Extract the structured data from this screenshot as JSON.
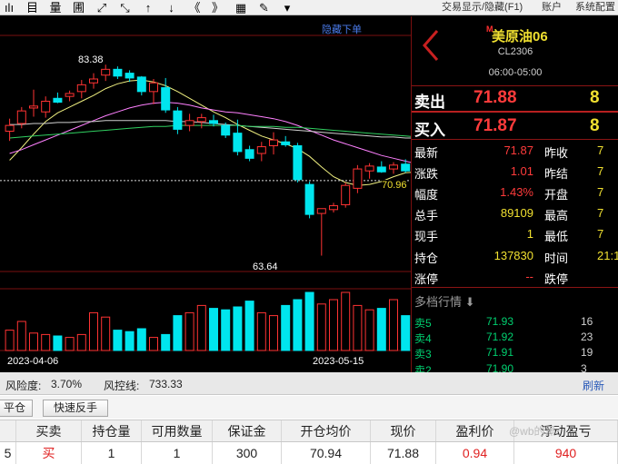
{
  "toolbar": {
    "icons": [
      "small-candle-icon",
      "list-icon",
      "volume-icon",
      "grid-icon",
      "zoom-in-icon",
      "zoom-out-icon",
      "arrow-up-icon",
      "arrow-down-icon",
      "double-left-icon",
      "double-right-icon",
      "layout-icon",
      "draw-icon",
      "dropdown-icon"
    ],
    "glyphs": [
      "ılı",
      "目",
      "量",
      "圃",
      "⤢",
      "⤡",
      "↑",
      "↓",
      "《",
      "》",
      "▦",
      "✎",
      "▾"
    ],
    "trade_toggle": "交易显示/隐藏(F1)",
    "account": "账户",
    "settings": "系统配置"
  },
  "chart": {
    "hide_order_label": "隐藏下单",
    "high_label": "83.38",
    "low_label": "63.64",
    "price_mark": "70.96",
    "date_start": "2023-04-06",
    "date_end": "2023-05-15"
  },
  "chart_data": {
    "type": "candlestick",
    "y_range": [
      62,
      88
    ],
    "candles": [
      {
        "o": 76.5,
        "h": 77.8,
        "l": 75.5,
        "c": 77.1
      },
      {
        "o": 77.3,
        "h": 79.0,
        "l": 76.8,
        "c": 78.6
      },
      {
        "o": 78.9,
        "h": 80.8,
        "l": 78.0,
        "c": 79.1
      },
      {
        "o": 78.5,
        "h": 80.1,
        "l": 77.9,
        "c": 79.6
      },
      {
        "o": 79.9,
        "h": 80.5,
        "l": 79.4,
        "c": 79.5
      },
      {
        "o": 80.1,
        "h": 80.7,
        "l": 79.6,
        "c": 80.4
      },
      {
        "o": 80.6,
        "h": 81.8,
        "l": 79.9,
        "c": 81.3
      },
      {
        "o": 81.5,
        "h": 82.5,
        "l": 80.9,
        "c": 81.9
      },
      {
        "o": 82.3,
        "h": 83.38,
        "l": 81.7,
        "c": 82.9
      },
      {
        "o": 82.9,
        "h": 83.2,
        "l": 81.9,
        "c": 82.2
      },
      {
        "o": 82.5,
        "h": 82.8,
        "l": 81.6,
        "c": 82.0
      },
      {
        "o": 82.1,
        "h": 82.2,
        "l": 80.2,
        "c": 80.6
      },
      {
        "o": 80.6,
        "h": 81.9,
        "l": 79.3,
        "c": 81.5
      },
      {
        "o": 81.0,
        "h": 82.0,
        "l": 78.4,
        "c": 78.7
      },
      {
        "o": 78.6,
        "h": 79.0,
        "l": 76.2,
        "c": 76.7
      },
      {
        "o": 77.1,
        "h": 78.3,
        "l": 76.5,
        "c": 77.6
      },
      {
        "o": 77.5,
        "h": 78.3,
        "l": 76.8,
        "c": 77.9
      },
      {
        "o": 77.6,
        "h": 78.2,
        "l": 77.0,
        "c": 77.3
      },
      {
        "o": 77.1,
        "h": 77.4,
        "l": 75.8,
        "c": 76.1
      },
      {
        "o": 76.3,
        "h": 77.7,
        "l": 74.0,
        "c": 74.4
      },
      {
        "o": 74.6,
        "h": 75.0,
        "l": 73.4,
        "c": 73.7
      },
      {
        "o": 74.2,
        "h": 75.4,
        "l": 73.4,
        "c": 74.9
      },
      {
        "o": 75.0,
        "h": 76.4,
        "l": 74.1,
        "c": 75.6
      },
      {
        "o": 75.4,
        "h": 76.0,
        "l": 74.9,
        "c": 75.1
      },
      {
        "o": 75.0,
        "h": 75.3,
        "l": 71.2,
        "c": 71.5
      },
      {
        "o": 71.0,
        "h": 71.3,
        "l": 67.5,
        "c": 67.9
      },
      {
        "o": 68.0,
        "h": 68.3,
        "l": 63.64,
        "c": 68.5
      },
      {
        "o": 68.4,
        "h": 69.1,
        "l": 68.1,
        "c": 68.8
      },
      {
        "o": 68.9,
        "h": 71.2,
        "l": 68.6,
        "c": 70.9
      },
      {
        "o": 70.6,
        "h": 73.0,
        "l": 70.1,
        "c": 72.6
      },
      {
        "o": 72.4,
        "h": 73.2,
        "l": 71.6,
        "c": 72.9
      },
      {
        "o": 72.8,
        "h": 73.4,
        "l": 72.2,
        "c": 72.3
      },
      {
        "o": 72.6,
        "h": 73.3,
        "l": 72.1,
        "c": 73.0
      },
      {
        "o": 73.1,
        "h": 73.6,
        "l": 72.2,
        "c": 72.4
      },
      {
        "o": 72.2,
        "h": 72.8,
        "l": 70.9,
        "c": 71.2
      },
      {
        "o": 71.5,
        "h": 71.9,
        "l": 69.3,
        "c": 70.2
      },
      {
        "o": 70.4,
        "h": 71.3,
        "l": 69.6,
        "c": 70.9
      },
      {
        "o": 70.7,
        "h": 71.8,
        "l": 69.8,
        "c": 70.4
      },
      {
        "o": 70.3,
        "h": 71.7,
        "l": 70.1,
        "c": 71.4
      }
    ],
    "volume": [
      28,
      40,
      24,
      22,
      20,
      18,
      22,
      52,
      46,
      28,
      26,
      30,
      18,
      22,
      48,
      52,
      62,
      58,
      56,
      60,
      68,
      52,
      48,
      62,
      70,
      80,
      64,
      70,
      80,
      62,
      56,
      58,
      70,
      48,
      50,
      52,
      42,
      40,
      16
    ],
    "volume_up": [
      true,
      true,
      true,
      true,
      false,
      true,
      true,
      true,
      true,
      false,
      false,
      false,
      true,
      false,
      false,
      true,
      true,
      false,
      false,
      false,
      false,
      true,
      true,
      false,
      false,
      false,
      true,
      true,
      true,
      true,
      true,
      false,
      true,
      false,
      false,
      false,
      true,
      false,
      true
    ],
    "ma_series": [
      {
        "color": "#f0f080",
        "values": [
          73.5,
          74.8,
          76.2,
          77.5,
          78.4,
          79.0,
          79.6,
          80.2,
          80.9,
          81.4,
          81.7,
          81.8,
          81.6,
          81.2,
          80.6,
          79.9,
          79.2,
          78.5,
          77.9,
          77.2,
          76.6,
          76.0,
          75.6,
          75.2,
          74.7,
          73.9,
          72.8,
          71.8,
          71.2,
          70.9,
          71.0,
          71.3,
          71.8,
          72.2,
          72.3,
          72.1,
          71.8,
          71.5,
          71.2
        ]
      },
      {
        "color": "#ff80ff",
        "values": [
          74.2,
          74.6,
          75.1,
          75.6,
          76.1,
          76.6,
          77.1,
          77.6,
          78.1,
          78.5,
          78.9,
          79.2,
          79.4,
          79.5,
          79.4,
          79.2,
          78.9,
          78.7,
          78.5,
          78.4,
          78.2,
          78.0,
          77.8,
          77.5,
          77.1,
          76.6,
          76.1,
          75.6,
          75.2,
          74.8,
          74.4,
          74.0,
          73.7,
          73.4,
          73.1,
          72.9,
          72.7,
          72.5,
          72.3
        ]
      },
      {
        "color": "#d0d0d0",
        "values": [
          77.2,
          77.2,
          77.3,
          77.3,
          77.4,
          77.4,
          77.5,
          77.5,
          77.6,
          77.6,
          77.6,
          77.6,
          77.6,
          77.6,
          77.5,
          77.5,
          77.4,
          77.3,
          77.2,
          77.1,
          77.0,
          76.9,
          76.8,
          76.7,
          76.6,
          76.5,
          76.4,
          76.3,
          76.2,
          76.1,
          76.0,
          75.9,
          75.9,
          75.8,
          75.8,
          75.8,
          75.8,
          75.8,
          75.8
        ]
      },
      {
        "color": "#30d060",
        "values": [
          75.8,
          75.9,
          76.0,
          76.1,
          76.2,
          76.3,
          76.4,
          76.5,
          76.6,
          76.7,
          76.8,
          76.9,
          77.0,
          77.0,
          77.1,
          77.1,
          77.1,
          77.1,
          77.1,
          77.1,
          77.0,
          77.0,
          77.0,
          76.9,
          76.9,
          76.8,
          76.7,
          76.6,
          76.5,
          76.4,
          76.3,
          76.2,
          76.1,
          76.0,
          75.9,
          75.9,
          75.8,
          75.8,
          75.8
        ]
      }
    ]
  },
  "quote": {
    "name": "美原油06",
    "mark": "M",
    "code": "CL2306",
    "session": "06:00-05:00",
    "sell_label": "卖出",
    "sell_price": "71.88",
    "sell_vol": "8",
    "buy_label": "买入",
    "buy_price": "71.87",
    "buy_vol": "8",
    "rows": [
      {
        "l1": "最新",
        "v1": "71.87",
        "c1": "#ff3b3b",
        "l2": "昨收",
        "v2": "7"
      },
      {
        "l1": "涨跌",
        "v1": "1.01",
        "c1": "#ff3b3b",
        "l2": "昨结",
        "v2": "7"
      },
      {
        "l1": "幅度",
        "v1": "1.43%",
        "c1": "#ff3b3b",
        "l2": "开盘",
        "v2": "7"
      },
      {
        "l1": "总手",
        "v1": "89109",
        "c1": "#f0e030",
        "l2": "最高",
        "v2": "7"
      },
      {
        "l1": "现手",
        "v1": "1",
        "c1": "#f0e030",
        "l2": "最低",
        "v2": "7"
      },
      {
        "l1": "持仓",
        "v1": "137830",
        "c1": "#f0e030",
        "l2": "时间",
        "v2": "21:1"
      },
      {
        "l1": "涨停",
        "v1": "--",
        "c1": "#ff3b3b",
        "l2": "跌停",
        "v2": ""
      }
    ],
    "depth_title": "多档行情",
    "depth": [
      {
        "label": "卖5",
        "price": "71.93",
        "vol": "16"
      },
      {
        "label": "卖4",
        "price": "71.92",
        "vol": "23"
      },
      {
        "label": "卖3",
        "price": "71.91",
        "vol": "19"
      },
      {
        "label": "卖2",
        "price": "71.90",
        "vol": "3"
      }
    ]
  },
  "bottom": {
    "risk_label": "风险度:",
    "risk_value": "3.70%",
    "control_label": "风控线:",
    "control_value": "733.33",
    "refresh": "刷新",
    "btn_close": "平仓",
    "btn_reverse": "快速反手",
    "columns": [
      "",
      "买卖",
      "持仓量",
      "可用数量",
      "保证金",
      "开仓均价",
      "现价",
      "盈利价",
      "浮动盈亏"
    ],
    "row": [
      "5",
      "买",
      "1",
      "1",
      "300",
      "70.94",
      "71.88",
      "0.94",
      "940"
    ],
    "watermark": "@wb的黑"
  }
}
